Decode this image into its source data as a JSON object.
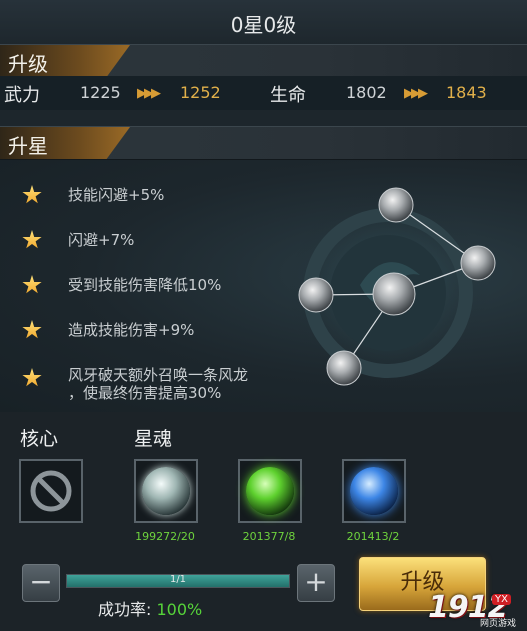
{
  "title": "0星0级",
  "upgrade_section": {
    "label": "升级",
    "stats": [
      {
        "name": "武力",
        "from": "1225",
        "to": "1252"
      },
      {
        "name": "生命",
        "from": "1802",
        "to": "1843"
      }
    ]
  },
  "star_section": {
    "label": "升星",
    "effects": [
      "技能闪避+5%",
      "闪避+7%",
      "受到技能伤害降低10%",
      "造成技能伤害+9%",
      "风牙破天额外召唤一条风龙",
      "，使最终伤害提高30%"
    ]
  },
  "core": {
    "label": "核心"
  },
  "star_soul": {
    "label": "星魂",
    "items": [
      {
        "count": "199272/20",
        "color": "#c8dad8"
      },
      {
        "count": "201377/8",
        "color": "#5ed12e"
      },
      {
        "count": "201413/2",
        "color": "#3d86e6"
      }
    ]
  },
  "stepper": {
    "minus": "−",
    "plus": "+",
    "progress_text": "1/1",
    "progress": 1.0
  },
  "success_rate": {
    "label": "成功率:",
    "value": "100%"
  },
  "upgrade_button": "升级",
  "watermark": {
    "number": "1912",
    "badge": "YX",
    "sub": "网页游戏"
  },
  "colors": {
    "accent_gold": "#e1b04a",
    "success_green": "#56d33a"
  }
}
